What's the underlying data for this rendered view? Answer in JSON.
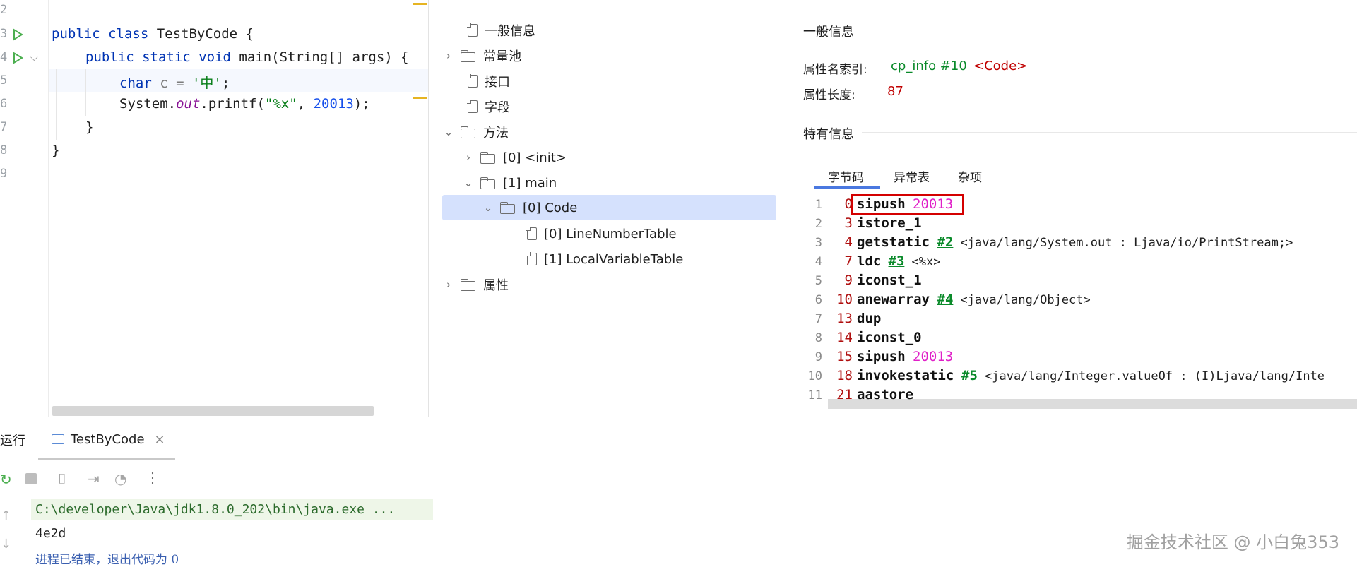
{
  "editor": {
    "line_numbers": [
      "2",
      "3",
      "4",
      "5",
      "6",
      "7",
      "8",
      "9"
    ],
    "code": {
      "l3_kw1": "public",
      "l3_kw2": "class",
      "l3_rest": " TestByCode {",
      "l4_kw1": "public",
      "l4_kw2": "static",
      "l4_kw3": "void",
      "l4_rest": " main(String[] args) {",
      "l5_kw": "char",
      "l5_var": " c = ",
      "l5_str": "'中'",
      "l5_end": ";",
      "l6_a": "System.",
      "l6_field": "out",
      "l6_b": ".printf(",
      "l6_str": "\"%x\"",
      "l6_c": ", ",
      "l6_num": "20013",
      "l6_d": ");",
      "l7": "}",
      "l8": "}"
    }
  },
  "tree": {
    "items": [
      {
        "label": "一般信息",
        "kind": "file"
      },
      {
        "label": "常量池",
        "kind": "folder"
      },
      {
        "label": "接口",
        "kind": "file"
      },
      {
        "label": "字段",
        "kind": "file"
      },
      {
        "label": "方法",
        "kind": "folder"
      },
      {
        "label": "[0] <init>",
        "kind": "folder"
      },
      {
        "label": "[1] main",
        "kind": "folder"
      },
      {
        "label": "[0] Code",
        "kind": "folder"
      },
      {
        "label": "[0] LineNumberTable",
        "kind": "file"
      },
      {
        "label": "[1] LocalVariableTable",
        "kind": "file"
      },
      {
        "label": "属性",
        "kind": "folder"
      }
    ]
  },
  "info": {
    "general_title": "一般信息",
    "attr_name_label": "属性名索引:",
    "attr_name_link": "cp_info #10",
    "attr_name_value": "<Code>",
    "attr_len_label": "属性长度:",
    "attr_len_value": "87",
    "specific_title": "特有信息",
    "tabs": [
      "字节码",
      "异常表",
      "杂项"
    ],
    "bytecode": [
      {
        "n": "1",
        "off": "0",
        "op": "sipush",
        "arg": "20013",
        "link": "",
        "desc": ""
      },
      {
        "n": "2",
        "off": "3",
        "op": "istore_1",
        "arg": "",
        "link": "",
        "desc": ""
      },
      {
        "n": "3",
        "off": "4",
        "op": "getstatic",
        "arg": "",
        "link": "#2",
        "desc": "<java/lang/System.out : Ljava/io/PrintStream;>"
      },
      {
        "n": "4",
        "off": "7",
        "op": "ldc",
        "arg": "",
        "link": "#3",
        "desc": "<%x>"
      },
      {
        "n": "5",
        "off": "9",
        "op": "iconst_1",
        "arg": "",
        "link": "",
        "desc": ""
      },
      {
        "n": "6",
        "off": "10",
        "op": "anewarray",
        "arg": "",
        "link": "#4",
        "desc": "<java/lang/Object>"
      },
      {
        "n": "7",
        "off": "13",
        "op": "dup",
        "arg": "",
        "link": "",
        "desc": ""
      },
      {
        "n": "8",
        "off": "14",
        "op": "iconst_0",
        "arg": "",
        "link": "",
        "desc": ""
      },
      {
        "n": "9",
        "off": "15",
        "op": "sipush",
        "arg": "20013",
        "link": "",
        "desc": ""
      },
      {
        "n": "10",
        "off": "18",
        "op": "invokestatic",
        "arg": "",
        "link": "#5",
        "desc": "<java/lang/Integer.valueOf : (I)Ljava/lang/Inte"
      },
      {
        "n": "11",
        "off": "21",
        "op": "aastore",
        "arg": "",
        "link": "",
        "desc": ""
      }
    ]
  },
  "run": {
    "title": "运行",
    "tab_label": "TestByCode",
    "close": "×",
    "console": {
      "cmd": "C:\\developer\\Java\\jdk1.8.0_202\\bin\\java.exe ...",
      "out": "4e2d",
      "exit": "进程已结束，退出代码为 0"
    }
  },
  "watermark": "掘金技术社区 @ 小白兔353",
  "colors": {
    "selection": "#d5e1fd",
    "keyword": "#0033b3",
    "string": "#067d17",
    "run_green": "#4caf50",
    "highlight_box": "#d40000",
    "bytecode_arg": "#e020c8"
  }
}
